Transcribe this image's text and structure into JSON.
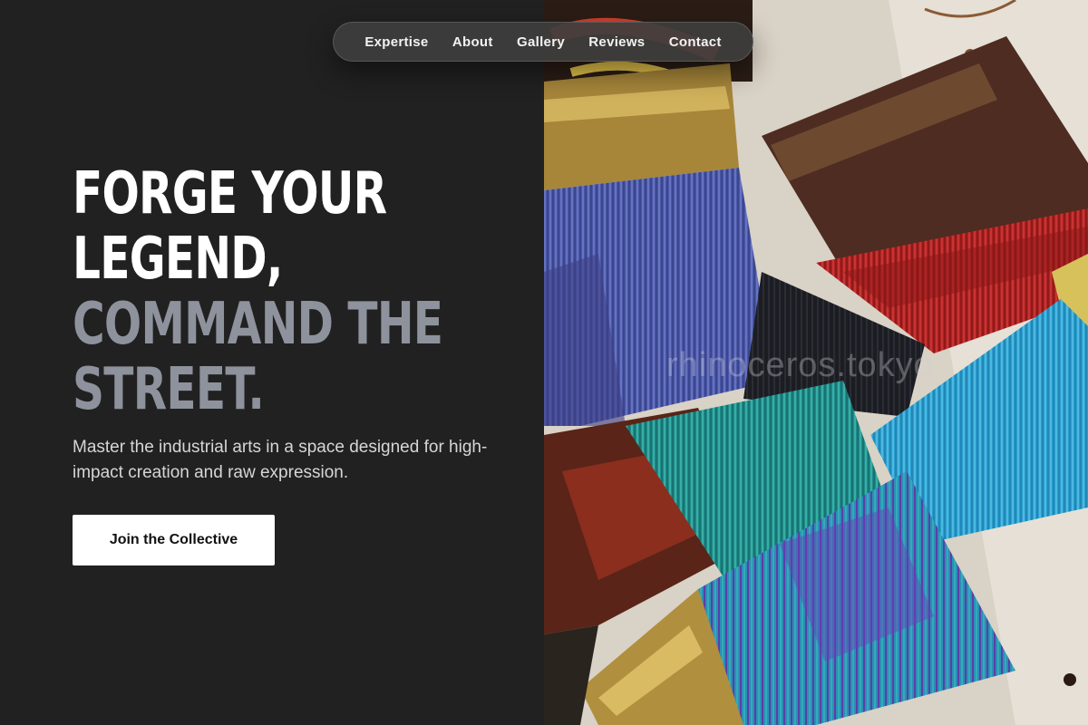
{
  "nav": {
    "items": [
      {
        "label": "Expertise"
      },
      {
        "label": "About"
      },
      {
        "label": "Gallery"
      },
      {
        "label": "Reviews"
      },
      {
        "label": "Contact"
      }
    ]
  },
  "hero": {
    "headline": {
      "line1": "FORGE YOUR",
      "line2": "LEGEND,",
      "line3": "COMMAND THE",
      "line4": "STREET."
    },
    "subtext": "Master the industrial arts in a space designed for high-impact creation and raw expression.",
    "cta_label": "Join the Collective",
    "image_watermark": "rhinoceros.tokyo"
  },
  "colors": {
    "background": "#212121",
    "headline_primary": "#ffffff",
    "headline_muted": "#8e929c",
    "cta_background": "#ffffff"
  }
}
